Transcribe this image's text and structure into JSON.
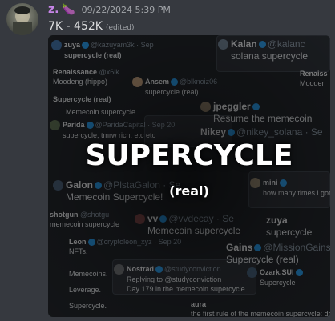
{
  "message": {
    "username": "z.",
    "emoji": "🍆",
    "timestamp": "09/22/2024 5:39 PM",
    "content": "7K - 452K",
    "edited_label": "(edited)"
  },
  "attachment": {
    "title": "SUPERCYCLE",
    "subtitle": "(real)",
    "tweets": [
      {
        "name": "zuya",
        "handle": "@kazuyam3k · Sep",
        "body": "supercycle (real)"
      },
      {
        "name": "Kalan",
        "handle": "@kalanc",
        "body": "solana supercycle"
      },
      {
        "name": "Renaissance",
        "handle": "@x6lk",
        "body": "Moodeng (hippo)"
      },
      {
        "name": "Ansem",
        "handle": "@blknoiz06",
        "body": "supercycle (real)"
      },
      {
        "name": "Renaiss",
        "handle": "",
        "body": "Mooden"
      },
      {
        "name": "",
        "handle": "",
        "body": "Supercycle (real)"
      },
      {
        "name": "",
        "handle": "",
        "body": "Memecoin supercycle"
      },
      {
        "name": "jpeggler",
        "handle": "",
        "body": "Resume the memecoin"
      },
      {
        "name": "Parida",
        "handle": "@ParidaCapital · Sep 20",
        "body": "supercycle, tmrw rich, etc etc"
      },
      {
        "name": "Nikey",
        "handle": "@nikey_solana · Se",
        "body": ""
      },
      {
        "name": "Galon",
        "handle": "@PlstaGalon · Se",
        "body": "Memecoin Supercycle!"
      },
      {
        "name": "mini",
        "handle": "",
        "body": "how many times i gotta t"
      },
      {
        "name": "shotgun",
        "handle": "@shotgu",
        "body": "memecoin supercycle"
      },
      {
        "name": "vv",
        "handle": "@vvdecay · Se",
        "body": "Memecoin supercycle"
      },
      {
        "name": "zuya",
        "handle": "",
        "body": "supercycle"
      },
      {
        "name": "Leon",
        "handle": "@cryptoleon_xyz · Sep 20",
        "body": "NFTs."
      },
      {
        "name": "Gains",
        "handle": "@MissionGains · Se",
        "body": "Supercycle (real)"
      },
      {
        "name": "Nostrad",
        "handle": "@studyconviction",
        "body": "Day 179 in the memecoin supercycle"
      },
      {
        "name": "Ozark.SUI",
        "handle": "",
        "body": "Supercycle"
      },
      {
        "name": "",
        "handle": "",
        "body": "Memecoins."
      },
      {
        "name": "",
        "handle": "",
        "body": "Leverage."
      },
      {
        "name": "",
        "handle": "",
        "body": "Supercycle."
      },
      {
        "name": "aura",
        "handle": "",
        "body": "the first rule of the memecoin supercycle: don't fad"
      }
    ],
    "replying_label": "Replying to @studyconviction"
  }
}
